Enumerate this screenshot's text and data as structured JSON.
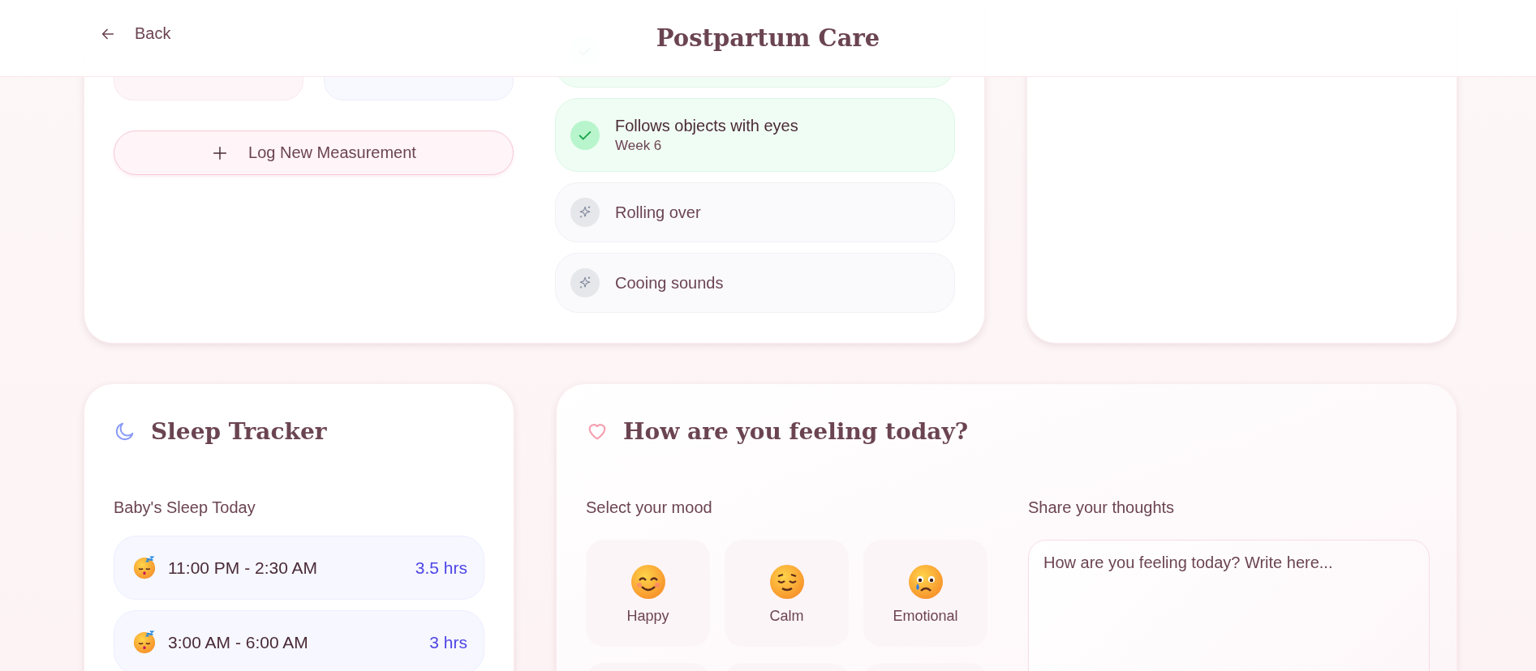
{
  "header": {
    "back_label": "Back",
    "title": "Postpartum Care"
  },
  "growth": {
    "log_button": "Log New Measurement"
  },
  "milestones": [
    {
      "achieved": true
    },
    {
      "title": "Follows objects with eyes",
      "week": "Week 6",
      "achieved": true
    },
    {
      "title": "Rolling over",
      "achieved": false
    },
    {
      "title": "Cooing sounds",
      "achieved": false
    }
  ],
  "sleep_tracker": {
    "title": "Sleep Tracker",
    "subtitle": "Baby's Sleep Today",
    "entries": [
      {
        "time": "11:00 PM - 2:30 AM",
        "duration": "3.5 hrs"
      },
      {
        "time": "3:00 AM - 6:00 AM",
        "duration": "3 hrs"
      }
    ]
  },
  "mood": {
    "title": "How are you feeling today?",
    "select_label": "Select your mood",
    "options": [
      {
        "label": "Happy",
        "kind": "happy",
        "selected": false
      },
      {
        "label": "Calm",
        "kind": "calm",
        "selected": false
      },
      {
        "label": "Emotional",
        "kind": "emotional",
        "selected": false
      }
    ],
    "thoughts_label": "Share your thoughts",
    "thoughts": {
      "placeholder": "How are you feeling today? Write here..."
    }
  }
}
